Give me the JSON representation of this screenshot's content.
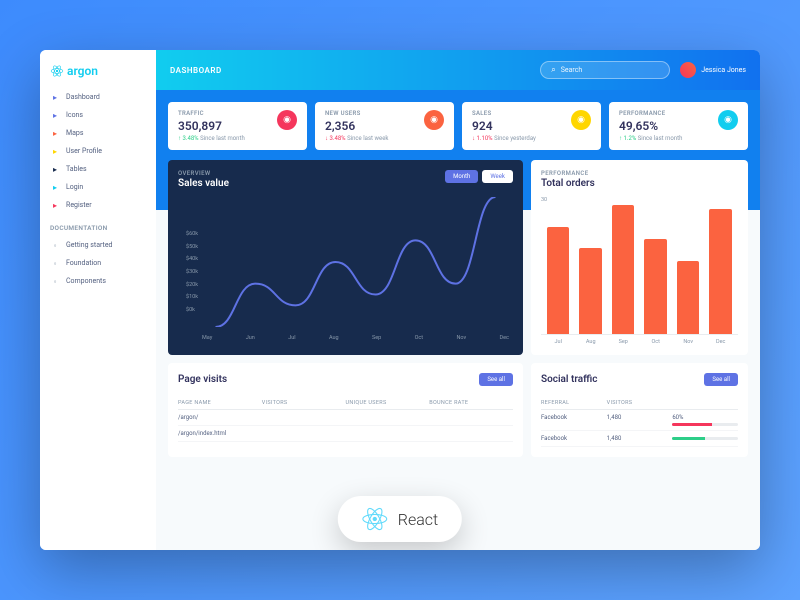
{
  "app": {
    "name": "argon"
  },
  "topbar": {
    "title": "DASHBOARD",
    "search_placeholder": "Search"
  },
  "user": {
    "name": "Jessica Jones"
  },
  "sidebar": {
    "items": [
      {
        "label": "Dashboard",
        "color": "#5e72e4"
      },
      {
        "label": "Icons",
        "color": "#5e72e4"
      },
      {
        "label": "Maps",
        "color": "#fb6340"
      },
      {
        "label": "User Profile",
        "color": "#ffd600"
      },
      {
        "label": "Tables",
        "color": "#172b4d"
      },
      {
        "label": "Login",
        "color": "#11cdef"
      },
      {
        "label": "Register",
        "color": "#f5365c"
      }
    ],
    "doc_heading": "DOCUMENTATION",
    "docs": [
      {
        "label": "Getting started"
      },
      {
        "label": "Foundation"
      },
      {
        "label": "Components"
      }
    ]
  },
  "stats": [
    {
      "label": "TRAFFIC",
      "value": "350,897",
      "delta": "3.48%",
      "dir": "up",
      "since": "Since last month",
      "icon": "chart-bar",
      "cls": "i-red"
    },
    {
      "label": "NEW USERS",
      "value": "2,356",
      "delta": "3.48%",
      "dir": "down",
      "since": "Since last week",
      "icon": "chart-pie",
      "cls": "i-orange"
    },
    {
      "label": "SALES",
      "value": "924",
      "delta": "1.10%",
      "dir": "down",
      "since": "Since yesterday",
      "icon": "users",
      "cls": "i-yellow"
    },
    {
      "label": "PERFORMANCE",
      "value": "49,65%",
      "delta": "1.2%",
      "dir": "up",
      "since": "Since last month",
      "icon": "percent",
      "cls": "i-teal"
    }
  ],
  "sales_chart": {
    "eyebrow": "OVERVIEW",
    "title": "Sales value",
    "toggle": {
      "a": "Month",
      "b": "Week"
    }
  },
  "orders_chart": {
    "eyebrow": "PERFORMANCE",
    "title": "Total orders"
  },
  "page_visits": {
    "title": "Page visits",
    "see_all": "See all",
    "cols": [
      "PAGE NAME",
      "VISITORS",
      "UNIQUE USERS",
      "BOUNCE RATE"
    ],
    "rows": [
      {
        "c0": "/argon/"
      },
      {
        "c0": "/argon/index.html"
      }
    ]
  },
  "social": {
    "title": "Social traffic",
    "see_all": "See all",
    "cols": [
      "REFERRAL",
      "VISITORS",
      ""
    ],
    "rows": [
      {
        "name": "Facebook",
        "visitors": "1,480",
        "pct": "60%",
        "color": "#f5365c"
      },
      {
        "name": "Facebook",
        "visitors": "1,480",
        "pct": "",
        "color": "#2dce89"
      }
    ]
  },
  "react_badge": "React",
  "chart_data": [
    {
      "type": "line",
      "title": "Sales value",
      "xlabel": "",
      "ylabel": "",
      "ylim": [
        0,
        60
      ],
      "yticks": [
        "$60k",
        "$50k",
        "$40k",
        "$30k",
        "$20k",
        "$10k",
        "$0k"
      ],
      "categories": [
        "May",
        "Jun",
        "Jul",
        "Aug",
        "Sep",
        "Oct",
        "Nov",
        "Dec"
      ],
      "values": [
        0,
        20,
        10,
        30,
        15,
        40,
        20,
        60
      ]
    },
    {
      "type": "bar",
      "title": "Total orders",
      "xlabel": "",
      "ylabel": "",
      "ylim": [
        0,
        30
      ],
      "categories": [
        "Jul",
        "Aug",
        "Sep",
        "Oct",
        "Nov",
        "Dec"
      ],
      "values": [
        25,
        20,
        30,
        22,
        17,
        29
      ]
    }
  ]
}
